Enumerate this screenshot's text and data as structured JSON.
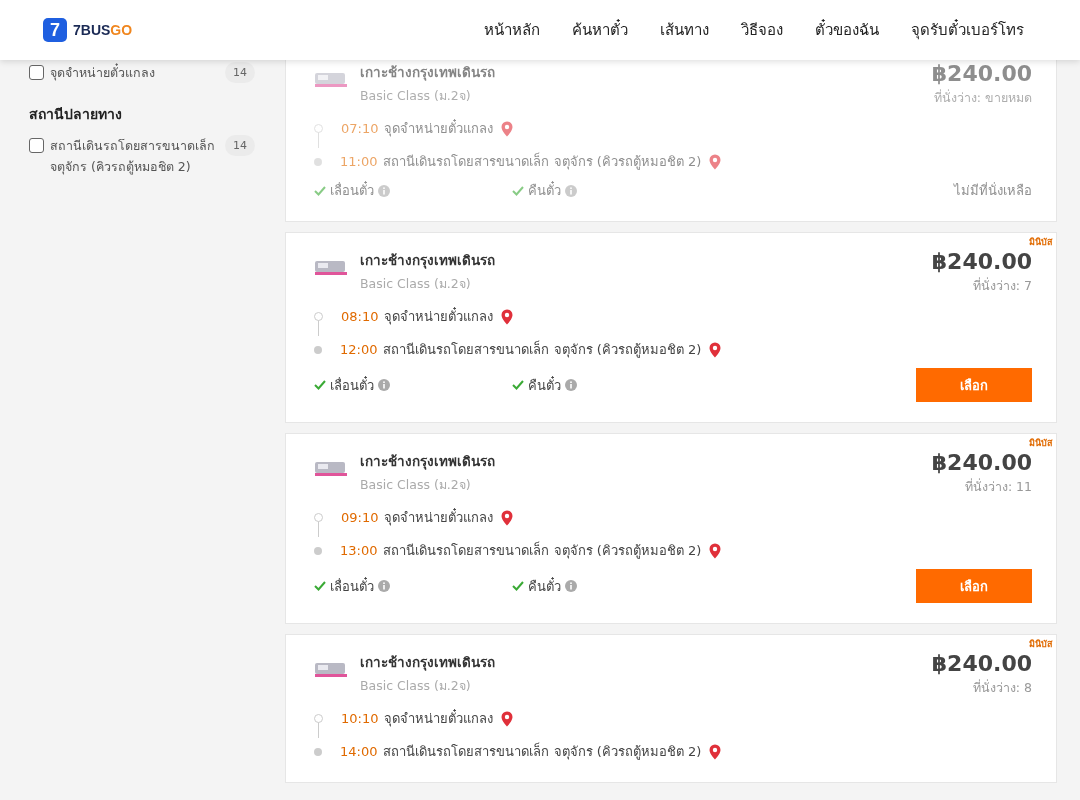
{
  "header": {
    "logo": {
      "mark": "7",
      "text_main": "7BUS",
      "text_accent": "GO"
    },
    "nav": [
      "หน้าหลัก",
      "ค้นหาตั๋ว",
      "เส้นทาง",
      "วิธีจอง",
      "ตั๋วของฉัน",
      "จุดรับตั๋วเบอร์โทร"
    ]
  },
  "sidebar": {
    "groups": [
      {
        "items": [
          {
            "label": "จุดจำหน่ายตั๋วแกลง",
            "count": "14",
            "checked": false
          }
        ]
      },
      {
        "title": "สถานีปลายทาง",
        "items": [
          {
            "label": "สถานีเดินรถโดยสารขนาดเล็ก จตุจักร (คิวรถตู้หมอชิต 2)",
            "count": "14",
            "checked": false
          }
        ]
      }
    ]
  },
  "trips": [
    {
      "sold_out": true,
      "operator": "เกาะช้างกรุงเทพเดินรถ",
      "class": "Basic Class (ม.2จ)",
      "price": "฿240.00",
      "seats": "ที่นั่งว่าง: ขายหมด",
      "departure": {
        "time": "07:10",
        "place": "จุดจำหน่ายตั๋วแกลง"
      },
      "arrival": {
        "time": "11:00",
        "place": "สถานีเดินรถโดยสารขนาดเล็ก จตุจักร (คิวรถตู้หมอชิต 2)"
      },
      "features": [
        "เลื่อนตั๋ว",
        "คืนตั๋ว"
      ],
      "action": {
        "kind": "note",
        "label": "ไม่มีที่นั่งเหลือ"
      }
    },
    {
      "sold_out": false,
      "badge": "มินิบัส",
      "operator": "เกาะช้างกรุงเทพเดินรถ",
      "class": "Basic Class (ม.2จ)",
      "price": "฿240.00",
      "seats": "ที่นั่งว่าง: 7",
      "departure": {
        "time": "08:10",
        "place": "จุดจำหน่ายตั๋วแกลง"
      },
      "arrival": {
        "time": "12:00",
        "place": "สถานีเดินรถโดยสารขนาดเล็ก จตุจักร (คิวรถตู้หมอชิต 2)"
      },
      "features": [
        "เลื่อนตั๋ว",
        "คืนตั๋ว"
      ],
      "action": {
        "kind": "button",
        "label": "เลือก"
      }
    },
    {
      "sold_out": false,
      "badge": "มินิบัส",
      "operator": "เกาะช้างกรุงเทพเดินรถ",
      "class": "Basic Class (ม.2จ)",
      "price": "฿240.00",
      "seats": "ที่นั่งว่าง: 11",
      "departure": {
        "time": "09:10",
        "place": "จุดจำหน่ายตั๋วแกลง"
      },
      "arrival": {
        "time": "13:00",
        "place": "สถานีเดินรถโดยสารขนาดเล็ก จตุจักร (คิวรถตู้หมอชิต 2)"
      },
      "features": [
        "เลื่อนตั๋ว",
        "คืนตั๋ว"
      ],
      "action": {
        "kind": "button",
        "label": "เลือก"
      }
    },
    {
      "sold_out": false,
      "badge": "มินิบัส",
      "operator": "เกาะช้างกรุงเทพเดินรถ",
      "class": "Basic Class (ม.2จ)",
      "price": "฿240.00",
      "seats": "ที่นั่งว่าง: 8",
      "departure": {
        "time": "10:10",
        "place": "จุดจำหน่ายตั๋วแกลง"
      },
      "arrival": {
        "time": "14:00",
        "place": "สถานีเดินรถโดยสารขนาดเล็ก จตุจักร (คิวรถตู้หมอชิต 2)"
      }
    }
  ]
}
